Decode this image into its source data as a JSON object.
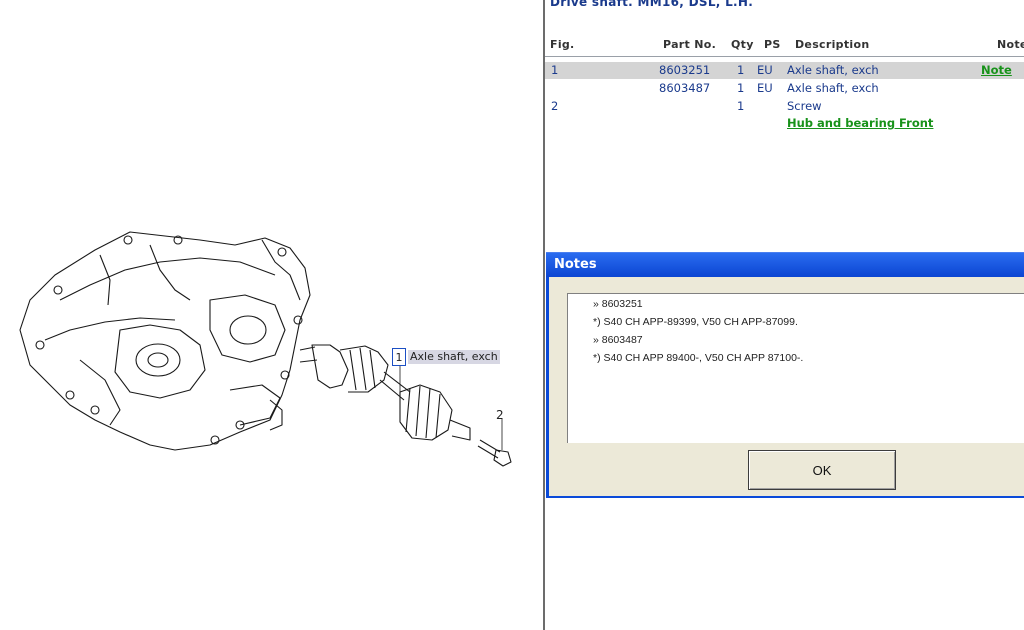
{
  "parts_list": {
    "title": "Drive shaft. MM16, DSL, L.H.",
    "columns": {
      "fig": "Fig.",
      "part_no": "Part No.",
      "qty": "Qty",
      "ps": "PS",
      "description": "Description",
      "note": "Note"
    },
    "rows": [
      {
        "fig": "1",
        "part_no": "8603251",
        "qty": "1",
        "ps": "EU",
        "description": "Axle shaft, exch",
        "note": "Note",
        "selected": true
      },
      {
        "fig": "",
        "part_no": "8603487",
        "qty": "1",
        "ps": "EU",
        "description": "Axle shaft, exch",
        "note": ""
      },
      {
        "fig": "2",
        "part_no": "",
        "qty": "1",
        "ps": "",
        "description": "Screw",
        "note": ""
      },
      {
        "fig": "",
        "part_no": "",
        "qty": "",
        "ps": "",
        "description": "Hub and bearing Front",
        "note": "",
        "link": true
      }
    ]
  },
  "diagram": {
    "callout_1_number": "1",
    "callout_1_label": "Axle shaft, exch",
    "callout_2_number": "2"
  },
  "notes_dialog": {
    "title": "Notes",
    "lines": [
      "» 8603251",
      "*) S40 CH APP-89399, V50 CH APP-87099.",
      "» 8603487",
      "*) S40 CH APP 89400-, V50 CH APP 87100-."
    ],
    "ok_label": "OK"
  }
}
